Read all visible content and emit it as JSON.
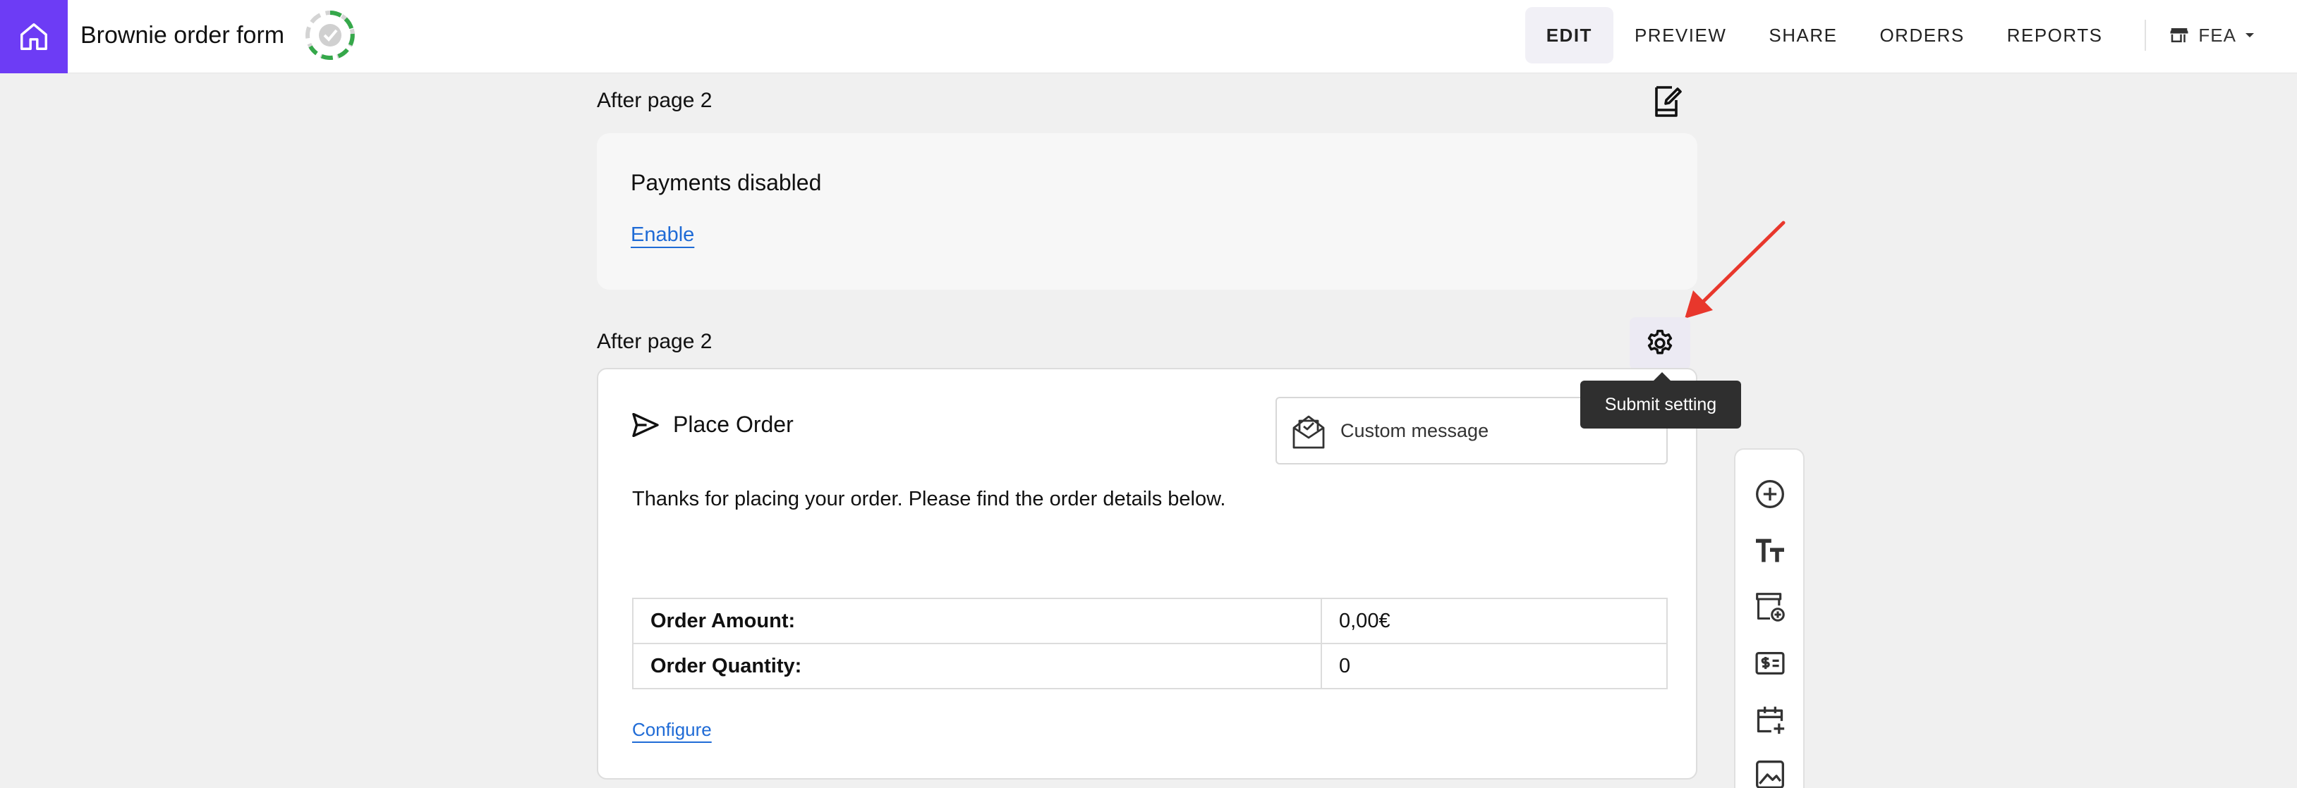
{
  "header": {
    "title": "Brownie order form",
    "nav": [
      "EDIT",
      "PREVIEW",
      "SHARE",
      "ORDERS",
      "REPORTS"
    ],
    "active_nav": "EDIT",
    "store_label": "FEA",
    "accent": "#6d3cf5"
  },
  "payment_section": {
    "label": "After page 2",
    "title": "Payments disabled",
    "link": "Enable"
  },
  "submit_section": {
    "label": "After page 2",
    "tooltip": "Submit setting",
    "title": "Place Order",
    "message_type": "Custom message",
    "body": "Thanks for placing your order. Please find the order details below.",
    "rows": [
      {
        "key": "Order Amount:",
        "value": "0,00€"
      },
      {
        "key": "Order Quantity:",
        "value": "0"
      }
    ],
    "configure_link": "Configure"
  },
  "toolbox": {
    "icons": [
      "add-circle-icon",
      "text-size-icon",
      "add-product-icon",
      "price-tag-icon",
      "calendar-add-icon",
      "image-icon"
    ]
  },
  "annotation": {
    "arrow_color": "#e8372c"
  }
}
